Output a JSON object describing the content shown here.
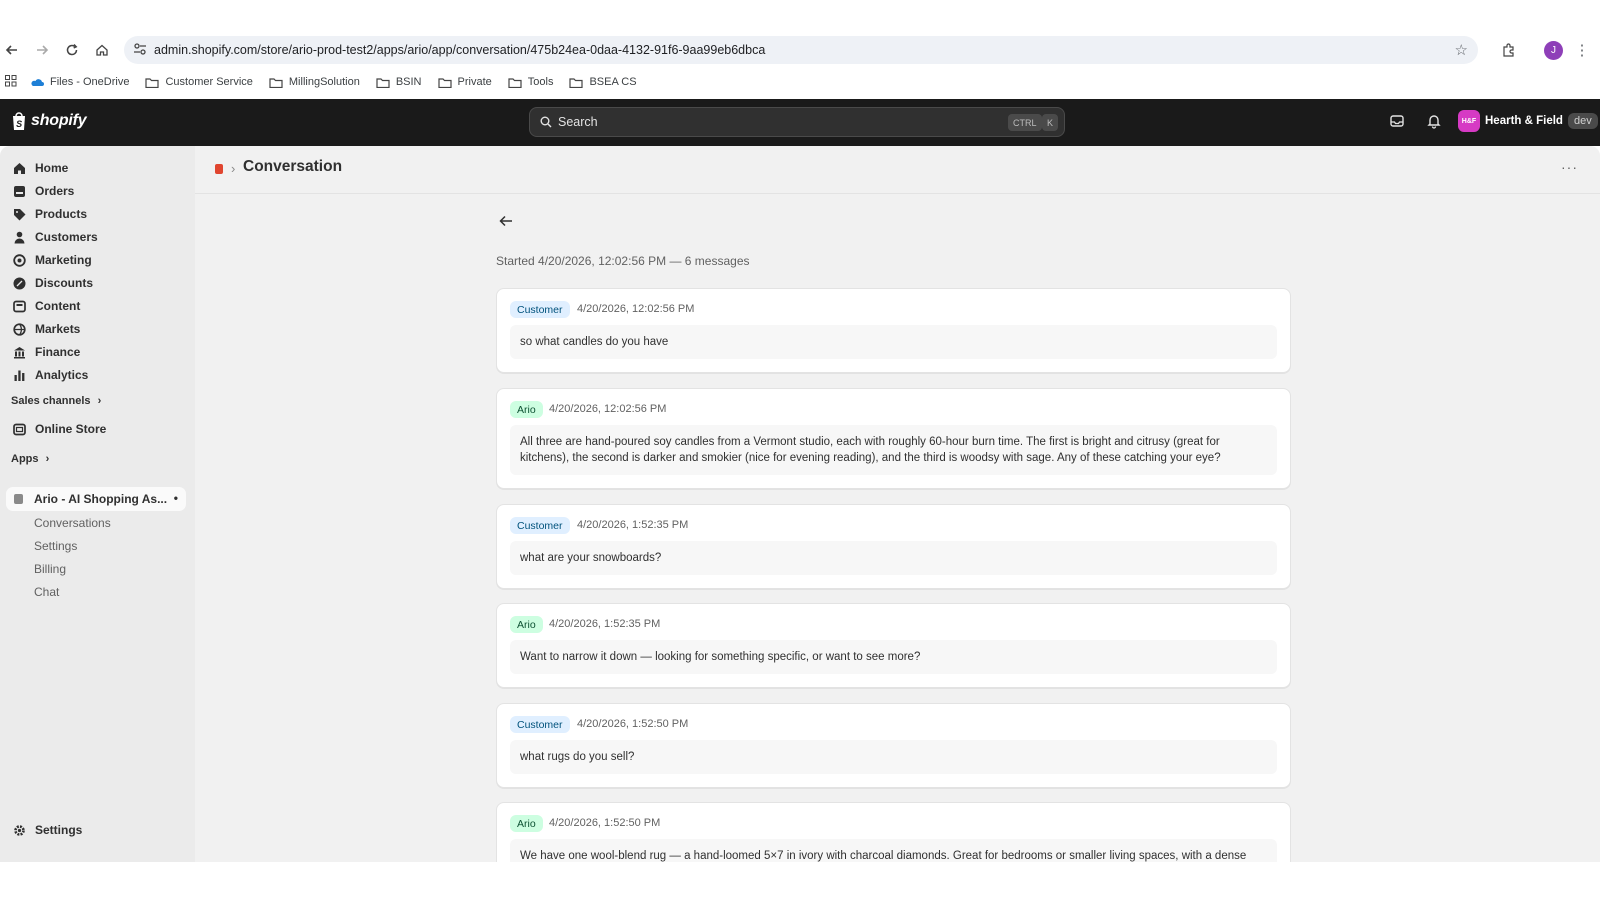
{
  "browser": {
    "url": "admin.shopify.com/store/ario-prod-test2/apps/ario/app/conversation/475b24ea-0daa-4132-91f6-9aa99eb6dbca",
    "profile_initial": "J",
    "bookmarks": [
      "Files - OneDrive",
      "Customer Service",
      "MillingSolution",
      "BSIN",
      "Private",
      "Tools",
      "BSEA CS"
    ]
  },
  "topbar": {
    "logo": "shopify",
    "search_placeholder": "Search",
    "kbd_ctrl": "CTRL",
    "kbd_k": "K",
    "store_initials": "H&F",
    "store_name": "Hearth & Field",
    "store_badge": "dev"
  },
  "sidebar": {
    "items": [
      "Home",
      "Orders",
      "Products",
      "Customers",
      "Marketing",
      "Discounts",
      "Content",
      "Markets",
      "Finance",
      "Analytics"
    ],
    "sales_channels": "Sales channels",
    "online_store": "Online Store",
    "apps": "Apps",
    "app_name": "Ario - AI Shopping As...",
    "app_sub": [
      "Conversations",
      "Settings",
      "Billing",
      "Chat"
    ],
    "settings": "Settings"
  },
  "page": {
    "title": "Conversation",
    "meta": "Started 4/20/2026, 12:02:56 PM — 6 messages"
  },
  "messages": [
    {
      "role": "Customer",
      "time": "4/20/2026, 12:02:56 PM",
      "text": "so what candles do you have"
    },
    {
      "role": "Ario",
      "time": "4/20/2026, 12:02:56 PM",
      "text": "All three are hand-poured soy candles from a Vermont studio, each with roughly 60-hour burn time. The first is bright and citrusy (great for kitchens), the second is darker and smokier (nice for evening reading), and the third is woodsy with sage. Any of these catching your eye?"
    },
    {
      "role": "Customer",
      "time": "4/20/2026, 1:52:35 PM",
      "text": "what are your snowboards?"
    },
    {
      "role": "Ario",
      "time": "4/20/2026, 1:52:35 PM",
      "text": "Want to narrow it down — looking for something specific, or want to see more?"
    },
    {
      "role": "Customer",
      "time": "4/20/2026, 1:52:50 PM",
      "text": "what rugs do you sell?"
    },
    {
      "role": "Ario",
      "time": "4/20/2026, 1:52:50 PM",
      "text": "We have one wool-blend rug — a hand-loomed 5×7 in ivory with charcoal diamonds. Great for bedrooms or smaller living spaces, with a dense"
    }
  ],
  "colors": {
    "topbar": "#1a1a1a",
    "customer_badge": "#e0efff",
    "ario_badge": "#cdfee1",
    "store_avatar": "#d63ac4"
  }
}
